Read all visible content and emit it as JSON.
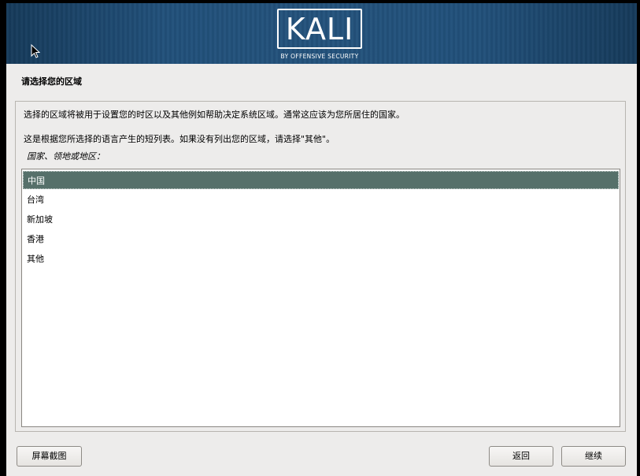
{
  "header": {
    "logo_text": "KALI",
    "logo_subtitle": "BY OFFENSIVE SECURITY"
  },
  "page": {
    "title": "请选择您的区域",
    "description_1": "选择的区域将被用于设置您的时区以及其他例如帮助决定系统区域。通常这应该为您所居住的国家。",
    "description_2": "这是根据您所选择的语言产生的短列表。如果没有列出您的区域，请选择\"其他\"。",
    "list_label": "国家、领地或地区："
  },
  "regions": [
    {
      "label": "中国",
      "selected": true
    },
    {
      "label": "台湾",
      "selected": false
    },
    {
      "label": "新加坡",
      "selected": false
    },
    {
      "label": "香港",
      "selected": false
    },
    {
      "label": "其他",
      "selected": false
    }
  ],
  "buttons": {
    "screenshot": "屏幕截图",
    "back": "返回",
    "continue": "继续"
  },
  "colors": {
    "banner": "#23527c",
    "selection": "#56706a",
    "window_bg": "#edeceb"
  }
}
